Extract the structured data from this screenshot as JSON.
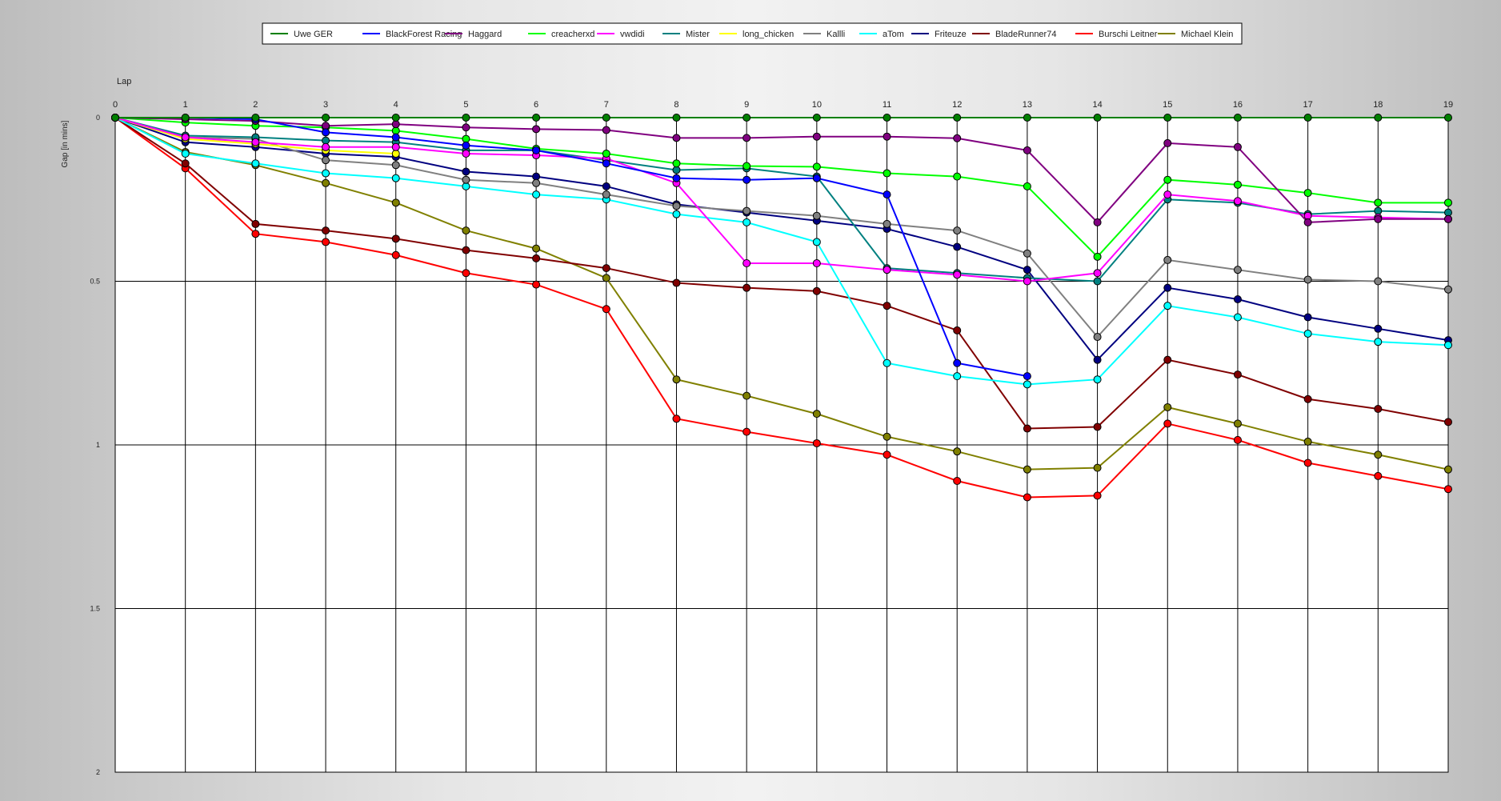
{
  "chart_data": {
    "type": "line",
    "xlabel": "Lap",
    "ylabel": "Gap [in mins]",
    "x": [
      0,
      1,
      2,
      3,
      4,
      5,
      6,
      7,
      8,
      9,
      10,
      11,
      12,
      13,
      14,
      15,
      16,
      17,
      18,
      19
    ],
    "ylim": [
      0,
      2
    ],
    "y_inverted": true,
    "y_ticks": [
      "0",
      "0.5",
      "1",
      "1.5",
      "2"
    ],
    "grid": true,
    "legend_position": "top-center",
    "series": [
      {
        "name": "Uwe GER",
        "color": "#008000",
        "values": [
          0,
          0,
          0,
          0,
          0,
          0,
          0,
          0,
          0,
          0,
          0,
          0,
          0,
          0,
          0,
          0,
          0,
          0,
          0,
          0
        ]
      },
      {
        "name": "BlackForest Racing",
        "color": "#0000ff",
        "values": [
          0,
          0,
          0.005,
          0.045,
          0.06,
          0.085,
          0.1,
          0.14,
          0.185,
          0.19,
          0.185,
          0.235,
          0.75,
          0.79,
          null,
          null,
          null,
          null,
          null,
          null
        ]
      },
      {
        "name": "Haggard",
        "color": "#800080",
        "values": [
          0,
          0.005,
          0.01,
          0.025,
          0.02,
          0.03,
          0.035,
          0.038,
          0.062,
          0.062,
          0.058,
          0.058,
          0.063,
          0.1,
          0.32,
          0.078,
          0.09,
          0.32,
          0.31,
          0.31
        ]
      },
      {
        "name": "creacherxd",
        "color": "#00ff00",
        "values": [
          0,
          0.015,
          0.025,
          0.03,
          0.04,
          0.065,
          0.095,
          0.11,
          0.14,
          0.148,
          0.15,
          0.17,
          0.18,
          0.21,
          0.425,
          0.19,
          0.205,
          0.23,
          0.26,
          0.26
        ]
      },
      {
        "name": "vwdidi",
        "color": "#ff00ff",
        "values": [
          0,
          0.06,
          0.075,
          0.09,
          0.09,
          0.11,
          0.115,
          0.125,
          0.2,
          0.445,
          0.445,
          0.465,
          0.48,
          0.5,
          0.475,
          0.235,
          0.255,
          0.3,
          0.305,
          0.31
        ]
      },
      {
        "name": "Mister",
        "color": "#008080",
        "values": [
          0,
          0.055,
          0.06,
          0.07,
          0.075,
          0.1,
          0.1,
          0.13,
          0.16,
          0.155,
          0.18,
          0.46,
          0.475,
          0.49,
          0.5,
          0.25,
          0.26,
          0.295,
          0.285,
          0.29
        ]
      },
      {
        "name": "long_chicken",
        "color": "#ffff00",
        "values": [
          0,
          0.065,
          0.08,
          0.1,
          0.11,
          null,
          null,
          null,
          null,
          null,
          null,
          null,
          null,
          null,
          null,
          null,
          null,
          null,
          null,
          null
        ]
      },
      {
        "name": "Kallli",
        "color": "#808080",
        "values": [
          0,
          0.06,
          0.065,
          0.13,
          0.145,
          0.19,
          0.2,
          0.235,
          0.27,
          0.285,
          0.3,
          0.325,
          0.345,
          0.415,
          0.67,
          0.435,
          0.465,
          0.495,
          0.5,
          0.525
        ]
      },
      {
        "name": "aTom",
        "color": "#00ffff",
        "values": [
          0,
          0.11,
          0.14,
          0.17,
          0.185,
          0.21,
          0.235,
          0.25,
          0.295,
          0.32,
          0.38,
          0.75,
          0.79,
          0.815,
          0.8,
          0.575,
          0.61,
          0.66,
          0.685,
          0.695
        ]
      },
      {
        "name": "Friteuze",
        "color": "#000080",
        "values": [
          0,
          0.075,
          0.09,
          0.11,
          0.12,
          0.165,
          0.18,
          0.21,
          0.265,
          0.29,
          0.315,
          0.34,
          0.395,
          0.465,
          0.74,
          0.52,
          0.555,
          0.61,
          0.645,
          0.68
        ]
      },
      {
        "name": "BladeRunner74",
        "color": "#800000",
        "values": [
          0,
          0.14,
          0.325,
          0.345,
          0.37,
          0.405,
          0.43,
          0.46,
          0.505,
          0.52,
          0.53,
          0.575,
          0.65,
          0.95,
          0.945,
          0.74,
          0.785,
          0.86,
          0.89,
          0.93
        ]
      },
      {
        "name": "Burschi Leitner",
        "color": "#ff0000",
        "values": [
          0,
          0.155,
          0.355,
          0.38,
          0.42,
          0.475,
          0.51,
          0.585,
          0.92,
          0.96,
          0.995,
          1.03,
          1.11,
          1.16,
          1.155,
          0.935,
          0.985,
          1.055,
          1.095,
          1.135
        ]
      },
      {
        "name": "Michael Klein",
        "color": "#808000",
        "values": [
          0,
          0.105,
          0.145,
          0.2,
          0.26,
          0.345,
          0.4,
          0.49,
          0.8,
          0.85,
          0.905,
          0.975,
          1.02,
          1.075,
          1.07,
          0.885,
          0.935,
          0.99,
          1.03,
          1.075
        ]
      }
    ]
  }
}
